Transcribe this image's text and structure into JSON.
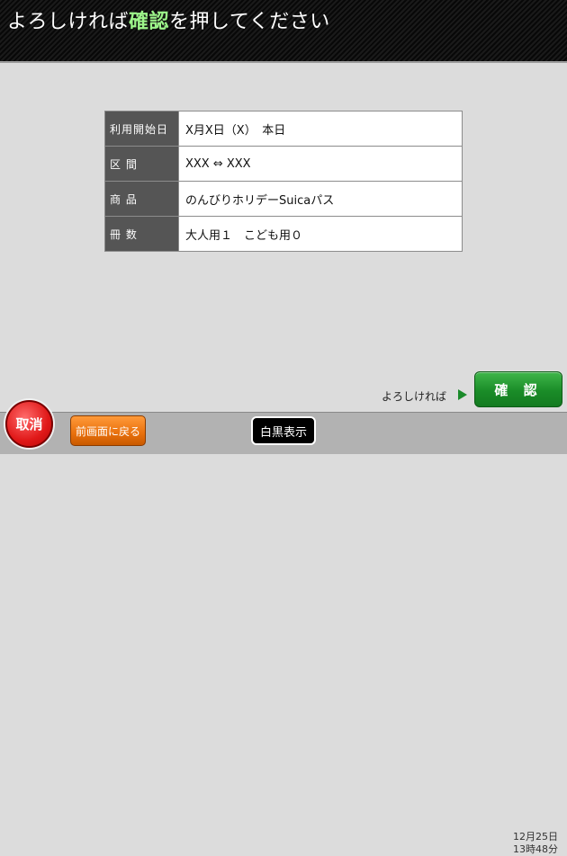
{
  "header": {
    "title_prefix": "よろしければ",
    "title_highlight": "確認",
    "title_suffix": "を押してください"
  },
  "ticket_info": {
    "rows": [
      {
        "label": "利用開始日",
        "value": "X月X日（X）　本日"
      },
      {
        "label": "区 間",
        "value": "XXX ⇔ XXX"
      },
      {
        "label": "商 品",
        "value": "のんびりホリデーSuicaパス"
      },
      {
        "label": "冊 数",
        "value": "大人用１　こども用０"
      }
    ]
  },
  "confirm": {
    "prompt": "よろしければ",
    "button_label": "確 認"
  },
  "footer": {
    "cancel_label": "取消",
    "back_label": "前画面に戻る",
    "mono_label": "白黒表示",
    "date": "12月25日",
    "time": "13時48分"
  },
  "colors": {
    "header_bg": "#101010",
    "highlight": "#9df58a",
    "confirm_green": "#1a8c28",
    "cancel_red": "#e01818",
    "back_orange": "#e8700c",
    "label_cell": "#555555"
  }
}
